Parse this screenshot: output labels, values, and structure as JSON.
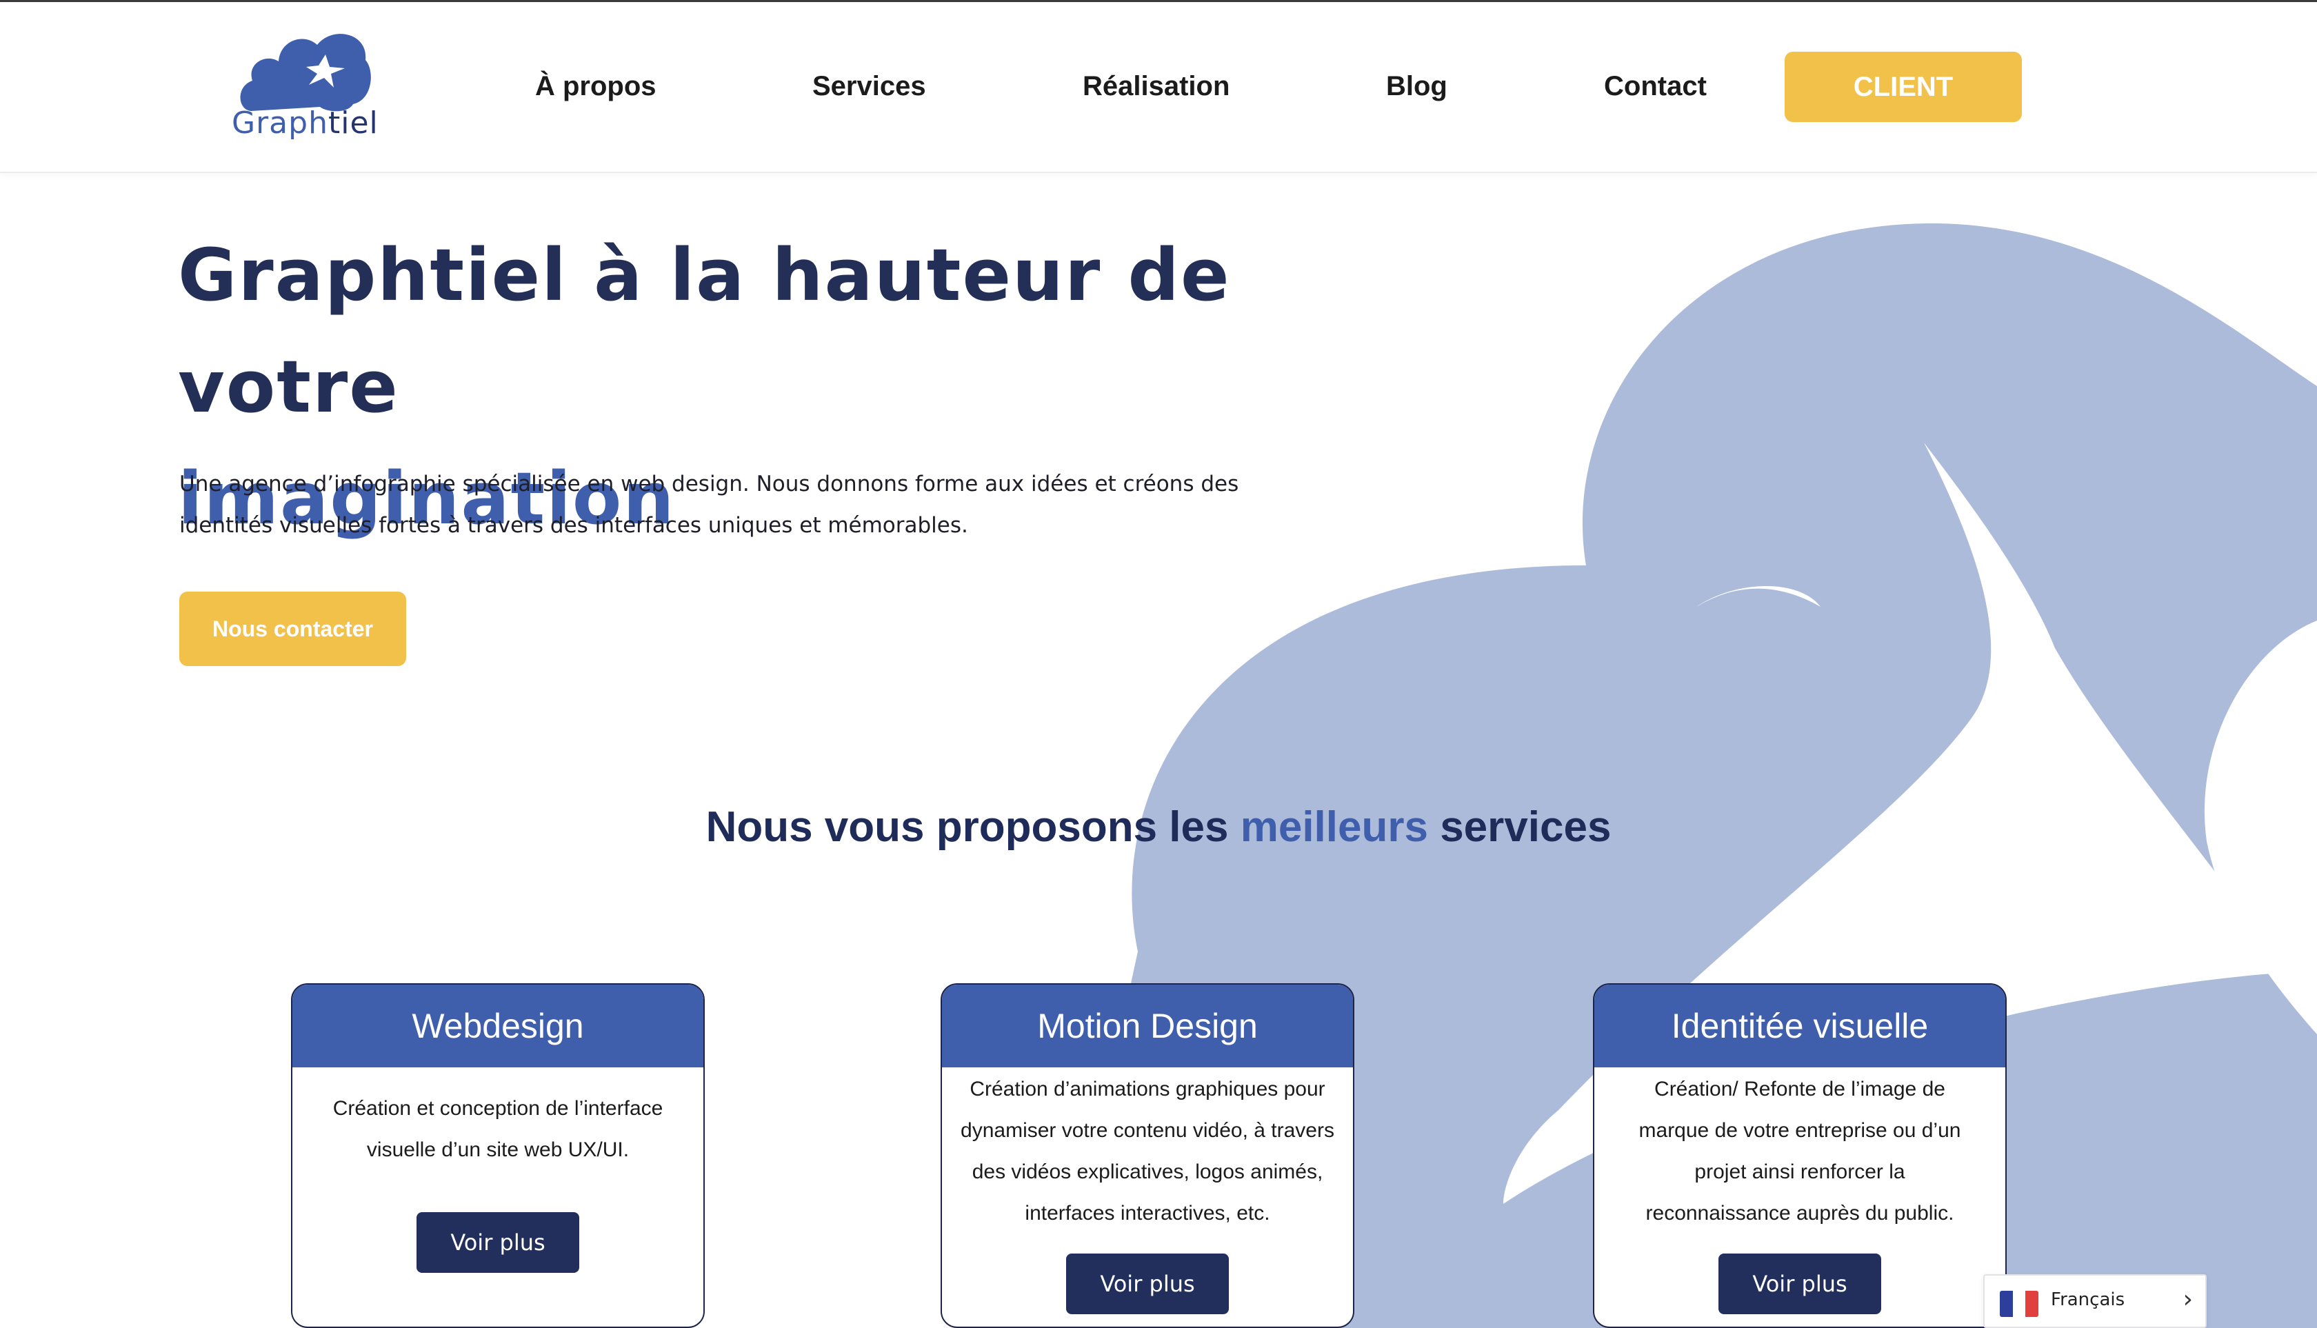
{
  "header": {
    "logo": {
      "text_part1": "Graph",
      "text_part2": "tiel"
    },
    "nav": [
      "À propos",
      "Services",
      "Réalisation",
      "Blog",
      "Contact"
    ],
    "client_button": "CLIENT"
  },
  "hero": {
    "title_line1": "Graphtiel à la hauteur de votre",
    "title_line2": "imagination",
    "description": "Une agence d’infographie spécialisée en web design. Nous donnons forme aux idées et créons des identités visuelles fortes à travers des interfaces uniques et mémorables.",
    "cta": "Nous contacter"
  },
  "services": {
    "heading_part1": "Nous vous proposons les",
    "heading_accent": "meilleurs",
    "heading_part2": "services",
    "cards": [
      {
        "title": "Webdesign",
        "text": "Création et conception de l’interface visuelle d’un site web UX/UI.",
        "button": "Voir plus"
      },
      {
        "title": "Motion Design",
        "text": "Création d’animations graphiques pour dynamiser votre contenu vidéo, à travers des vidéos explicatives, logos animés, interfaces interactives, etc.",
        "button": "Voir plus"
      },
      {
        "title": "Identitée visuelle",
        "text": "Création/ Refonte de l’image de marque de votre entreprise ou d’un projet ainsi renforcer la reconnaissance auprès du public.",
        "button": "Voir plus"
      }
    ]
  },
  "language": {
    "label": "Français",
    "flag": "france-flag",
    "chevron": "chevron-right-icon"
  },
  "colors": {
    "brand_blue": "#3f5eac",
    "navy": "#222e5c",
    "yellow": "#f2c14a",
    "cloud": "#adbbdb"
  }
}
